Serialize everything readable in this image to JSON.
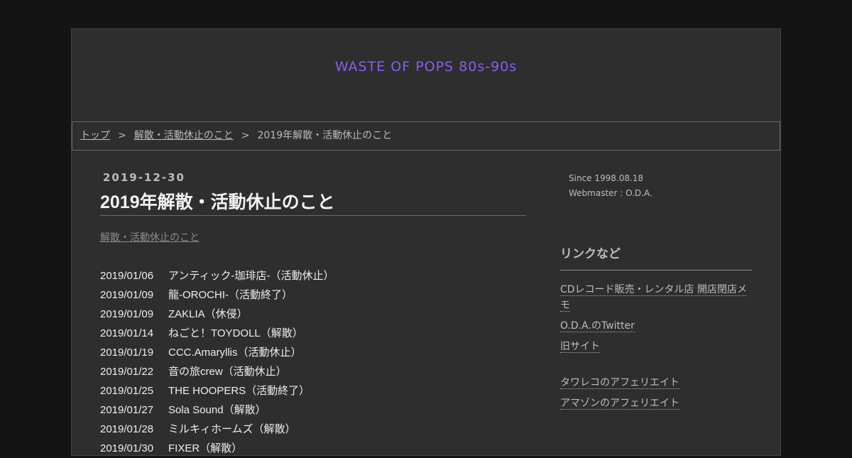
{
  "site": {
    "title": "WASTE OF POPS 80s-90s"
  },
  "breadcrumb": {
    "home": "トップ",
    "sep": ">",
    "category": "解散・活動休止のこと",
    "current": "2019年解散・活動休止のこと"
  },
  "post": {
    "date": "2019-12-30",
    "title": "2019年解散・活動休止のこと",
    "category": "解散・活動休止のこと",
    "entries": [
      {
        "date": "2019/01/06",
        "text": "アンティック-珈琲店-（活動休止）"
      },
      {
        "date": "2019/01/09",
        "text": "龍-OROCHI-（活動終了）"
      },
      {
        "date": "2019/01/09",
        "text": "ZAKLIA（休侵）"
      },
      {
        "date": "2019/01/14",
        "text": "ねごと！TOYDOLL（解散）"
      },
      {
        "date": "2019/01/19",
        "text": "CCC.Amaryllis（活動休止）"
      },
      {
        "date": "2019/01/22",
        "text": "音の旅crew（活動休止）"
      },
      {
        "date": "2019/01/25",
        "text": "THE HOOPERS（活動終了）"
      },
      {
        "date": "2019/01/27",
        "text": "Sola Sound（解散）"
      },
      {
        "date": "2019/01/28",
        "text": "ミルキィホームズ（解散）"
      },
      {
        "date": "2019/01/30",
        "text": "FIXER（解散）"
      }
    ]
  },
  "sidebar": {
    "since": "Since 1998.08.18",
    "webmaster": "Webmaster : O.D.A.",
    "links_heading": "リンクなど",
    "links": [
      "CDレコード販売・レンタル店 開店閉店メモ",
      "O.D.A.のTwitter",
      "旧サイト",
      "タワレコのアフェリエイト",
      "アマゾンのアフェリエイト"
    ]
  }
}
